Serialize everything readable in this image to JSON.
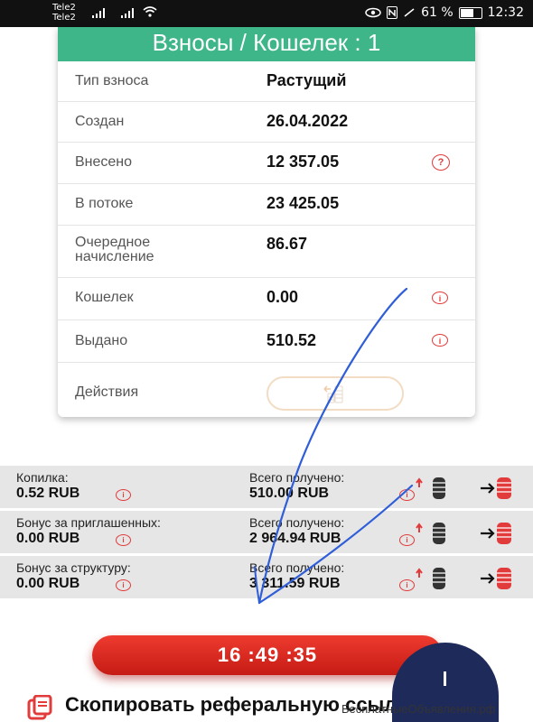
{
  "status_bar": {
    "carrier1": "Tele2",
    "carrier2": "Tele2",
    "battery": "61 %",
    "time": "12:32"
  },
  "card": {
    "title": "Взносы / Кошелек : 1",
    "rows": [
      {
        "label": "Тип взноса",
        "value": "Растущий"
      },
      {
        "label": "Создан",
        "value": "26.04.2022"
      },
      {
        "label": "Внесено",
        "value": "12 357.05"
      },
      {
        "label": "В потоке",
        "value": "23 425.05"
      },
      {
        "label": "Очередное начисление",
        "value": "86.67"
      },
      {
        "label": "Кошелек",
        "value": "0.00"
      },
      {
        "label": "Выдано",
        "value": "510.52"
      },
      {
        "label": "Действия",
        "value": ""
      }
    ]
  },
  "bonuses": [
    {
      "title": "Копилка:",
      "amount": "0.52 RUB",
      "total_label": "Всего получено:",
      "total": "510.00 RUB"
    },
    {
      "title": "Бонус за приглашенных:",
      "amount": "0.00 RUB",
      "total_label": "Всего получено:",
      "total": "2 964.94 RUB"
    },
    {
      "title": "Бонус за структуру:",
      "amount": "0.00 RUB",
      "total_label": "Всего получено:",
      "total": "3 311.59 RUB"
    }
  ],
  "timer": "16 :49 :35",
  "copy_text": "Скопировать реферальную ссылку",
  "watermark": "БесплатныеОбъявления.рф",
  "colors": {
    "accent_green": "#3fb58a",
    "red": "#e23b3b",
    "annotation_blue": "#2f5ed8"
  },
  "icons": [
    "signal-icon",
    "wifi-icon",
    "eye-icon",
    "nfc-icon",
    "battery-icon",
    "info-icon",
    "wallet-icon",
    "coin-stack-icon",
    "transfer-icon",
    "copy-icon"
  ]
}
